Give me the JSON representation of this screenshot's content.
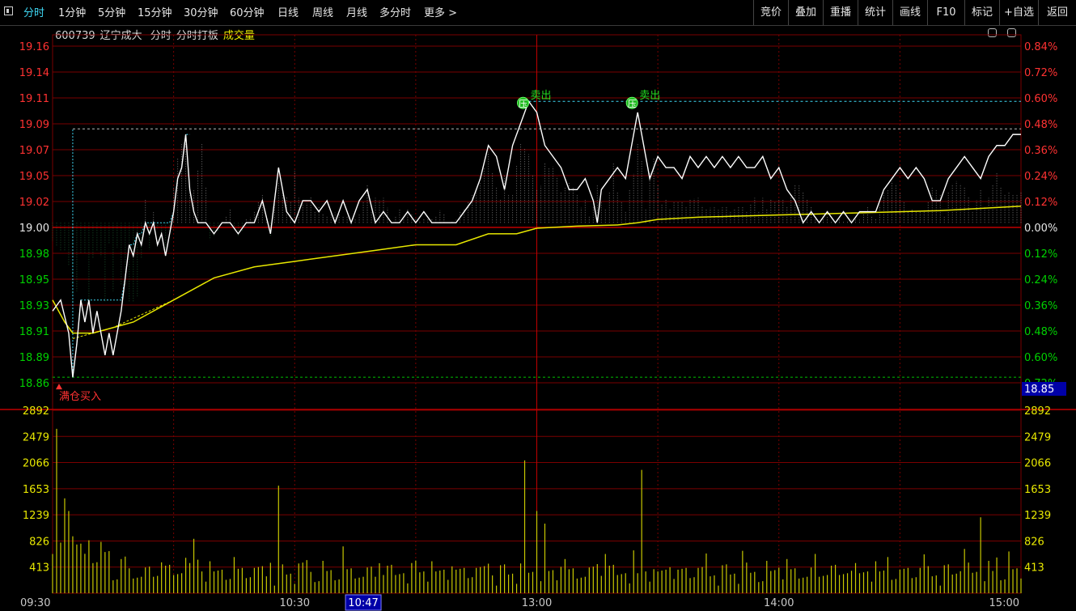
{
  "toolbar": {
    "tabs": [
      "分时",
      "1分钟",
      "5分钟",
      "15分钟",
      "30分钟",
      "60分钟",
      "日线",
      "周线",
      "月线",
      "多分时",
      "更多 >"
    ],
    "right_buttons": [
      "竞价",
      "叠加",
      "重播",
      "统计",
      "画线",
      "F10",
      "标记",
      "+自选",
      "返回"
    ]
  },
  "info": {
    "code": "600739",
    "name": "辽宁成大",
    "item1": "分时",
    "item2": "分时打板",
    "item3": "成交量"
  },
  "colors": {
    "up": "#ff3232",
    "down": "#00d000",
    "price": "#ffffff",
    "avg": "#e8e800",
    "grid": "#7a0000",
    "cyan": "#3fd8f4"
  },
  "chart_data": {
    "type": "line",
    "price_ticks": [
      "19.16",
      "19.14",
      "19.11",
      "19.09",
      "19.07",
      "19.05",
      "19.02",
      "19.00",
      "18.98",
      "18.95",
      "18.93",
      "18.91",
      "18.89",
      "18.86"
    ],
    "pct_ticks": [
      "0.84%",
      "0.72%",
      "0.60%",
      "0.48%",
      "0.36%",
      "0.24%",
      "0.12%",
      "0.00%",
      "0.12%",
      "0.24%",
      "0.36%",
      "0.48%",
      "0.60%",
      "0.72%"
    ],
    "prev_close": 19.0,
    "ylim": [
      18.855,
      19.16
    ],
    "current_price_tag": "18.85",
    "volume_ticks": [
      "2892",
      "2479",
      "2066",
      "1653",
      "1239",
      "826",
      "413"
    ],
    "volume_ylim": [
      0,
      2892
    ],
    "time_labels": [
      "09:30",
      "10:30",
      "10:47",
      "13:00",
      "14:00",
      "15:00"
    ],
    "annotations": [
      {
        "text": "满仓买入",
        "minute": 2,
        "price": 18.86
      },
      {
        "text": "卖出",
        "minute": 118,
        "price": 19.11,
        "badge": "压"
      },
      {
        "text": "卖出",
        "minute": 145,
        "price": 19.11,
        "badge": "压"
      }
    ],
    "ref_lines": [
      {
        "price": 19.11,
        "style": "cyan-dash",
        "from_minute": 118
      },
      {
        "price": 19.085,
        "style": "gray-dash",
        "from_minute": 5
      },
      {
        "price": 18.86,
        "style": "green-dash",
        "from_minute": 0
      }
    ],
    "price_keypoints": [
      [
        0,
        18.92
      ],
      [
        2,
        18.93
      ],
      [
        4,
        18.9
      ],
      [
        5,
        18.86
      ],
      [
        6,
        18.89
      ],
      [
        7,
        18.93
      ],
      [
        8,
        18.91
      ],
      [
        9,
        18.93
      ],
      [
        10,
        18.9
      ],
      [
        11,
        18.92
      ],
      [
        12,
        18.9
      ],
      [
        13,
        18.88
      ],
      [
        14,
        18.9
      ],
      [
        15,
        18.88
      ],
      [
        16,
        18.9
      ],
      [
        17,
        18.92
      ],
      [
        18,
        18.95
      ],
      [
        19,
        18.98
      ],
      [
        20,
        18.97
      ],
      [
        21,
        18.99
      ],
      [
        22,
        18.98
      ],
      [
        23,
        19.0
      ],
      [
        24,
        18.99
      ],
      [
        25,
        19.0
      ],
      [
        26,
        18.98
      ],
      [
        27,
        18.99
      ],
      [
        28,
        18.97
      ],
      [
        30,
        19.01
      ],
      [
        31,
        19.04
      ],
      [
        32,
        19.05
      ],
      [
        33,
        19.08
      ],
      [
        34,
        19.03
      ],
      [
        35,
        19.01
      ],
      [
        36,
        19.0
      ],
      [
        38,
        19.0
      ],
      [
        40,
        18.99
      ],
      [
        42,
        19.0
      ],
      [
        44,
        19.0
      ],
      [
        46,
        18.99
      ],
      [
        48,
        19.0
      ],
      [
        50,
        19.0
      ],
      [
        52,
        19.02
      ],
      [
        54,
        18.99
      ],
      [
        56,
        19.05
      ],
      [
        58,
        19.01
      ],
      [
        60,
        19.0
      ],
      [
        62,
        19.02
      ],
      [
        64,
        19.02
      ],
      [
        66,
        19.01
      ],
      [
        68,
        19.02
      ],
      [
        70,
        19.0
      ],
      [
        72,
        19.02
      ],
      [
        74,
        19.0
      ],
      [
        76,
        19.02
      ],
      [
        78,
        19.03
      ],
      [
        80,
        19.0
      ],
      [
        82,
        19.01
      ],
      [
        84,
        19.0
      ],
      [
        86,
        19.0
      ],
      [
        88,
        19.01
      ],
      [
        90,
        19.0
      ],
      [
        92,
        19.01
      ],
      [
        94,
        19.0
      ],
      [
        96,
        19.0
      ],
      [
        98,
        19.0
      ],
      [
        100,
        19.0
      ],
      [
        102,
        19.01
      ],
      [
        104,
        19.02
      ],
      [
        106,
        19.04
      ],
      [
        108,
        19.07
      ],
      [
        110,
        19.06
      ],
      [
        112,
        19.03
      ],
      [
        114,
        19.07
      ],
      [
        116,
        19.09
      ],
      [
        118,
        19.11
      ],
      [
        120,
        19.1
      ],
      [
        122,
        19.07
      ],
      [
        124,
        19.06
      ],
      [
        126,
        19.05
      ],
      [
        128,
        19.03
      ],
      [
        130,
        19.03
      ],
      [
        132,
        19.04
      ],
      [
        134,
        19.02
      ],
      [
        135,
        19.0
      ],
      [
        136,
        19.03
      ],
      [
        138,
        19.04
      ],
      [
        140,
        19.05
      ],
      [
        142,
        19.04
      ],
      [
        144,
        19.08
      ],
      [
        145,
        19.1
      ],
      [
        146,
        19.08
      ],
      [
        148,
        19.04
      ],
      [
        150,
        19.06
      ],
      [
        152,
        19.05
      ],
      [
        154,
        19.05
      ],
      [
        156,
        19.04
      ],
      [
        158,
        19.06
      ],
      [
        160,
        19.05
      ],
      [
        162,
        19.06
      ],
      [
        164,
        19.05
      ],
      [
        166,
        19.06
      ],
      [
        168,
        19.05
      ],
      [
        170,
        19.06
      ],
      [
        172,
        19.05
      ],
      [
        174,
        19.05
      ],
      [
        176,
        19.06
      ],
      [
        178,
        19.04
      ],
      [
        180,
        19.05
      ],
      [
        182,
        19.03
      ],
      [
        184,
        19.02
      ],
      [
        186,
        19.0
      ],
      [
        188,
        19.01
      ],
      [
        190,
        19.0
      ],
      [
        192,
        19.01
      ],
      [
        194,
        19.0
      ],
      [
        196,
        19.01
      ],
      [
        198,
        19.0
      ],
      [
        200,
        19.01
      ],
      [
        202,
        19.01
      ],
      [
        204,
        19.01
      ],
      [
        206,
        19.03
      ],
      [
        208,
        19.04
      ],
      [
        210,
        19.05
      ],
      [
        212,
        19.04
      ],
      [
        214,
        19.05
      ],
      [
        216,
        19.04
      ],
      [
        218,
        19.02
      ],
      [
        220,
        19.02
      ],
      [
        222,
        19.04
      ],
      [
        224,
        19.05
      ],
      [
        226,
        19.06
      ],
      [
        228,
        19.05
      ],
      [
        230,
        19.04
      ],
      [
        232,
        19.06
      ],
      [
        234,
        19.07
      ],
      [
        236,
        19.07
      ],
      [
        238,
        19.08
      ],
      [
        240,
        19.08
      ]
    ],
    "avg_keypoints": [
      [
        0,
        18.93
      ],
      [
        3,
        18.91
      ],
      [
        5,
        18.9
      ],
      [
        10,
        18.9
      ],
      [
        20,
        18.91
      ],
      [
        30,
        18.93
      ],
      [
        40,
        18.95
      ],
      [
        50,
        18.96
      ],
      [
        60,
        18.965
      ],
      [
        70,
        18.97
      ],
      [
        80,
        18.975
      ],
      [
        90,
        18.98
      ],
      [
        100,
        18.98
      ],
      [
        108,
        18.99
      ],
      [
        115,
        18.99
      ],
      [
        120,
        18.995
      ],
      [
        130,
        18.997
      ],
      [
        140,
        18.998
      ],
      [
        145,
        19.0
      ],
      [
        150,
        19.003
      ],
      [
        160,
        19.005
      ],
      [
        170,
        19.006
      ],
      [
        180,
        19.007
      ],
      [
        190,
        19.008
      ],
      [
        200,
        19.009
      ],
      [
        210,
        19.01
      ],
      [
        220,
        19.011
      ],
      [
        230,
        19.013
      ],
      [
        240,
        19.015
      ]
    ]
  }
}
